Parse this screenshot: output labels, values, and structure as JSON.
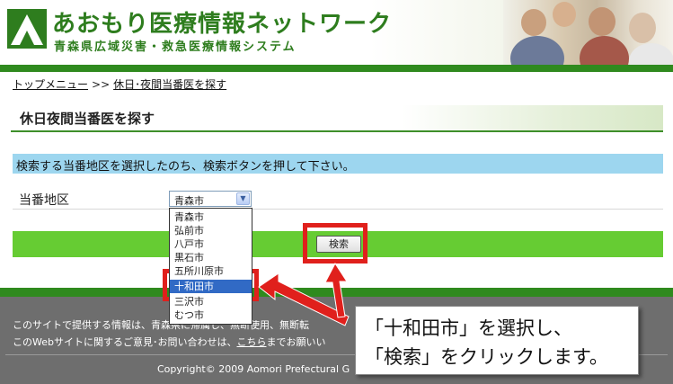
{
  "header": {
    "title": "あおもり医療情報ネットワーク",
    "subtitle": "青森県広域災害・救急医療情報システム"
  },
  "breadcrumb": {
    "top_menu": "トップメニュー",
    "separator": ">>",
    "current": "休日･夜間当番医を探す"
  },
  "page": {
    "title": "休日夜間当番医を探す",
    "instruction": "検索する当番地区を選択したのち、検索ボタンを押して下さい。"
  },
  "form": {
    "district_label": "当番地区",
    "selected": "青森市",
    "options": [
      "青森市",
      "弘前市",
      "八戸市",
      "黒石市",
      "五所川原市",
      "十和田市",
      "三沢市",
      "むつ市"
    ],
    "highlighted_option": "十和田市",
    "search_label": "検索"
  },
  "footer": {
    "line1": "このサイトで提供する情報は、青森県に帰属し、無断使用、無断転",
    "line2_pre": "このWebサイトに関するご意見･お問い合わせは、",
    "line2_link": "こちら",
    "line2_post": "までお願いい",
    "copyright": "Copyright© 2009 Aomori Prefectural G"
  },
  "callout": {
    "line1": "「十和田市」を選択し、",
    "line2": "「検索」をクリックします。"
  },
  "colors": {
    "brand_green": "#2f8a1e",
    "search_bar": "#66cc33",
    "instruction_bg": "#9dd6ef",
    "annotation_red": "#e0201c",
    "selection_blue": "#316ac5"
  }
}
